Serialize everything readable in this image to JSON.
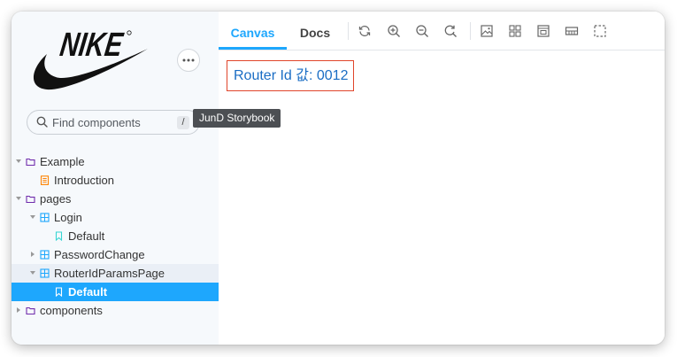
{
  "sidebar": {
    "brand": "NIKE",
    "search": {
      "placeholder": "Find components",
      "shortcut": "/"
    },
    "tooltip": "JunD Storybook",
    "tree": [
      {
        "label": "Example",
        "kind": "folder"
      },
      {
        "label": "Introduction",
        "kind": "document"
      },
      {
        "label": "pages",
        "kind": "folder"
      },
      {
        "label": "Login",
        "kind": "component"
      },
      {
        "label": "Default",
        "kind": "story"
      },
      {
        "label": "PasswordChange",
        "kind": "component"
      },
      {
        "label": "RouterIdParamsPage",
        "kind": "component"
      },
      {
        "label": "Default",
        "kind": "story",
        "selected": true
      },
      {
        "label": "components",
        "kind": "folder"
      }
    ]
  },
  "toolbar": {
    "tabs": [
      {
        "label": "Canvas",
        "active": true
      },
      {
        "label": "Docs",
        "active": false
      }
    ],
    "tools": [
      "reload-icon",
      "zoom-in-icon",
      "zoom-out-icon",
      "zoom-reset-icon",
      "background-icon",
      "grid-icon",
      "viewport-icon",
      "measure-icon",
      "outline-icon"
    ]
  },
  "canvas": {
    "text": "Router Id 값: 0012"
  },
  "colors": {
    "accent": "#1ea7fd",
    "highlight_border": "#e0452b",
    "link_text": "#1a6dc4",
    "folder_icon": "#6f2cac",
    "component_icon": "#1ea7fd",
    "document_icon": "#ff8300"
  }
}
